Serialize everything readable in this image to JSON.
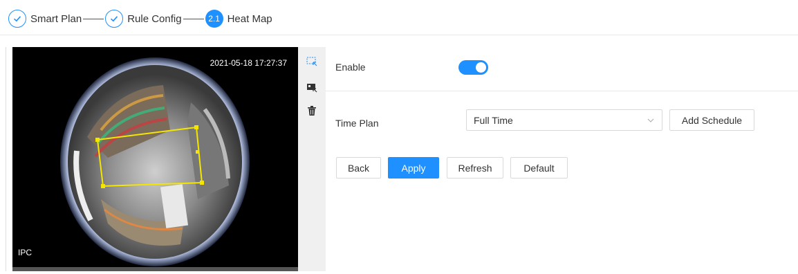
{
  "steps": [
    {
      "label": "Smart Plan",
      "state": "done",
      "icon": "check-icon"
    },
    {
      "label": "Rule Config",
      "state": "done",
      "icon": "check-icon"
    },
    {
      "label": "Heat Map",
      "state": "active",
      "number": "2.1"
    }
  ],
  "video": {
    "timestamp": "2021-05-18 17:27:37",
    "channel": "IPC"
  },
  "toolbar": {
    "tools": [
      "draw-rule-icon",
      "draw-region-icon",
      "delete-icon"
    ]
  },
  "form": {
    "enable_label": "Enable",
    "enable_on": true,
    "time_plan_label": "Time Plan",
    "time_plan_value": "Full Time"
  },
  "buttons": {
    "add_schedule": "Add Schedule",
    "back": "Back",
    "apply": "Apply",
    "refresh": "Refresh",
    "default": "Default"
  },
  "colors": {
    "accent": "#1e90ff",
    "rule_box": "#f5e600"
  }
}
